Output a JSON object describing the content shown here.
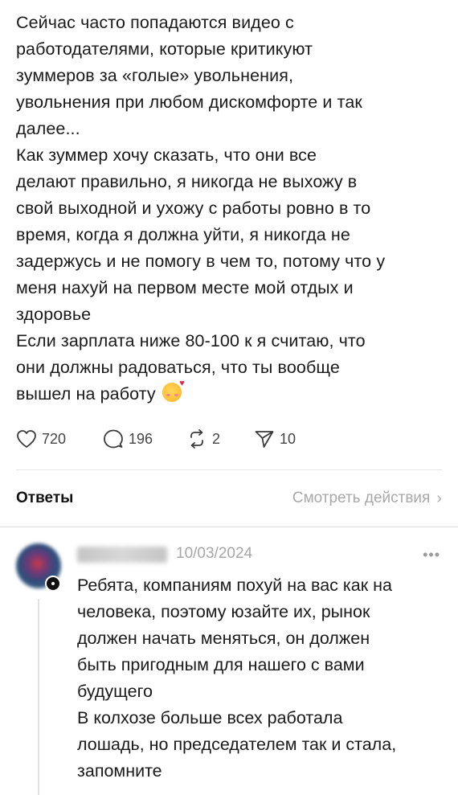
{
  "post": {
    "text": "Сейчас часто попадаются видео с\nработодателями, которые критикуют\nзуммеров за «голые» увольнения,\nувольнения при любом дискомфорте и так\nдалее...\nКак зуммер хочу сказать, что они все\nделают правильно, я никогда не выхожу в\nсвой выходной и ухожу с работы ровно в то\nвремя, когда я должна уйти, я никогда не\nзадержусь и не помогу в чем то, потому что у\nменя нахуй на первом месте мой отдых и\nздоровье\nЕсли зарплата ниже 80-100 к я  считаю, что\nони должны радоваться, что ты вообще\nвышел на работу",
    "emoji": "smiling-face-with-hearts"
  },
  "actions": {
    "likes": "720",
    "comments": "196",
    "reposts": "2",
    "shares": "10"
  },
  "replies": {
    "title": "Ответы",
    "view_activity": "Смотреть действия",
    "chevron": "›"
  },
  "reply": {
    "date": "10/03/2024",
    "more": "•••",
    "text": "Ребята, компаниям похуй на вас как на\nчеловека, поэтому юзайте их, рынок\nдолжен начать меняться, он должен\nбыть пригодным для нашего с вами\nбудущего\nВ колхозе больше всех работала\nлошадь, но председателем так и стала,\nзапомните"
  },
  "icons": {
    "like": "heart-icon",
    "comment": "comment-bubble-icon",
    "repost": "repost-icon",
    "share": "send-icon",
    "more": "more-icon"
  }
}
